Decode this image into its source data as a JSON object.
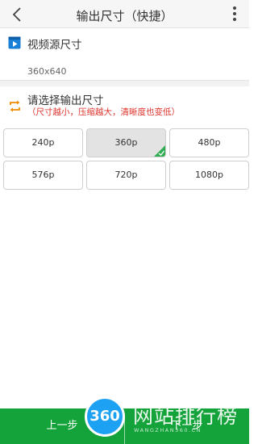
{
  "header": {
    "title": "输出尺寸（快捷）"
  },
  "source": {
    "label": "视频源尺寸",
    "value": "360x640"
  },
  "output": {
    "label": "请选择输出尺寸",
    "hint": "（尺寸越小，压缩越大，清晰度也变低）",
    "options": [
      "240p",
      "360p",
      "480p",
      "576p",
      "720p",
      "1080p"
    ],
    "selected": "360p"
  },
  "footer": {
    "prev_label": "上一步",
    "next_label": "下一步"
  },
  "watermark": {
    "logo": "360",
    "text": "网站排行榜",
    "sub": "WANGZHAN360.CN"
  },
  "colors": {
    "accent_green": "#14a33a",
    "hint_red": "#e0322b",
    "icon_blue": "#1a7fd6",
    "icon_orange": "#f08c00"
  }
}
